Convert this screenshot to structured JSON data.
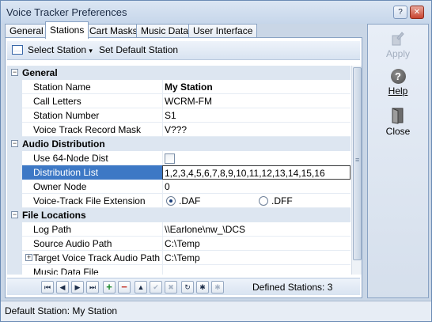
{
  "window": {
    "title": "Voice Tracker Preferences",
    "controls": {
      "help": "?",
      "close": "✕"
    }
  },
  "tabs": [
    {
      "label": "General"
    },
    {
      "label": "Stations",
      "active": true
    },
    {
      "label": "Cart Masks"
    },
    {
      "label": "Music Data"
    },
    {
      "label": "User Interface"
    }
  ],
  "toolbar": {
    "select_station": "Select Station",
    "set_default": "Set Default Station",
    "caret": "▾"
  },
  "grid": {
    "categories": {
      "general": "General",
      "audio": "Audio Distribution",
      "files": "File Locations"
    },
    "general": [
      {
        "name": "Station Name",
        "value": "My Station"
      },
      {
        "name": "Call Letters",
        "value": "WCRM-FM"
      },
      {
        "name": "Station Number",
        "value": "S1"
      },
      {
        "name": "Voice Track Record Mask",
        "value": "V???"
      }
    ],
    "audio": [
      {
        "name": "Use 64-Node Dist",
        "value": ""
      },
      {
        "name": "Distribution List",
        "value": "1,2,3,4,5,6,7,8,9,10,11,12,13,14,15,16"
      },
      {
        "name": "Owner Node",
        "value": "0"
      },
      {
        "name": "Voice-Track File Extension",
        "option_a": ".DAF",
        "option_b": ".DFF"
      }
    ],
    "files": [
      {
        "name": "Log Path",
        "value": "\\\\Earlone\\nw_\\DCS"
      },
      {
        "name": "Source Audio Path",
        "value": "C:\\Temp"
      },
      {
        "name": "Target Voice Track Audio Path",
        "value": "C:\\Temp"
      },
      {
        "name": "Music Data File",
        "value": ""
      }
    ],
    "toggle_open": "−",
    "toggle_closed": "+"
  },
  "navigator": {
    "first": "⏮",
    "prev": "◀",
    "next": "▶",
    "last": "⏭",
    "add": "+",
    "delete": "−",
    "up": "▲",
    "post": "✔",
    "cancel": "✖",
    "refresh": "↻",
    "star": "✱",
    "star2": "✱",
    "defined": "Defined Stations: 3"
  },
  "sidebar": {
    "apply": "Apply",
    "help": "Help",
    "close": "Close"
  },
  "status": {
    "text": "Default Station: My Station"
  }
}
